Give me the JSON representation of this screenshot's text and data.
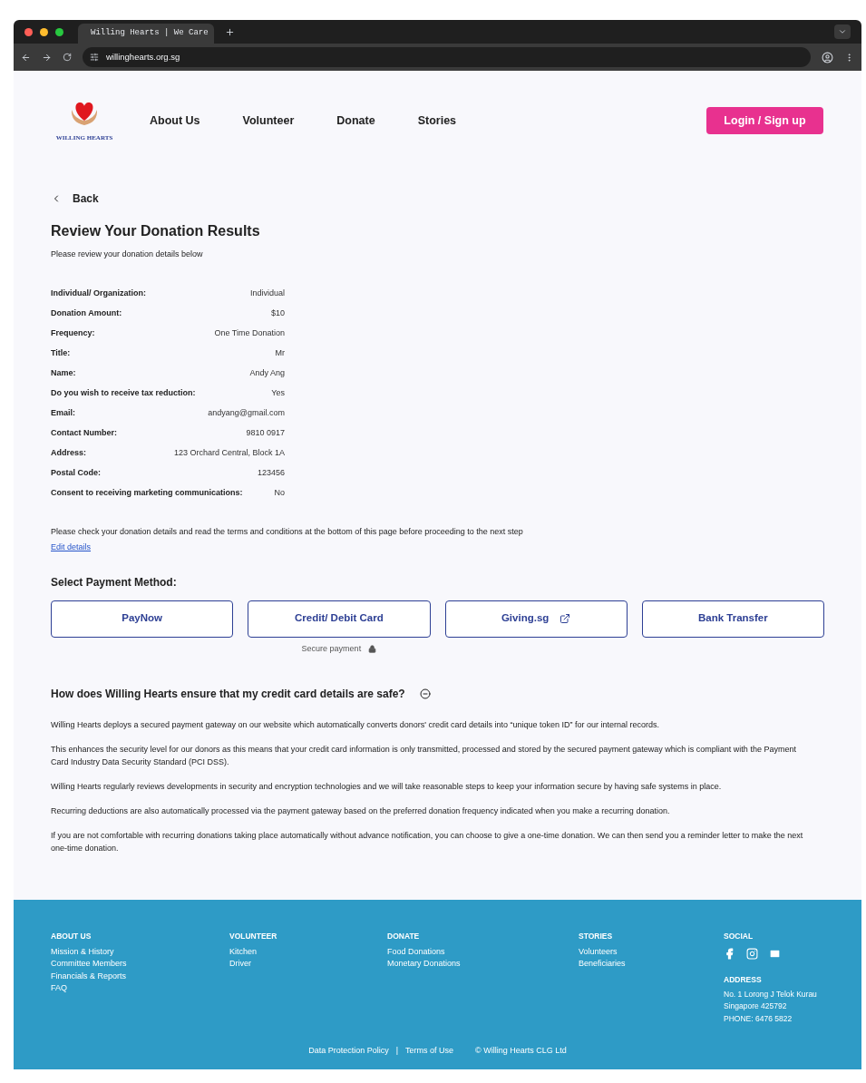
{
  "browser": {
    "tab_title": "Willing Hearts | We Care",
    "url": "willinghearts.org.sg"
  },
  "logo": {
    "text": "WILLING HEARTS"
  },
  "nav": [
    "About Us",
    "Volunteer",
    "Donate",
    "Stories"
  ],
  "login_button": "Login / Sign up",
  "back": "Back",
  "title": "Review Your Donation Results",
  "subtitle": "Please review your donation details below",
  "details": [
    {
      "label": "Individual/ Organization:",
      "value": "Individual"
    },
    {
      "label": "Donation Amount:",
      "value": "$10"
    },
    {
      "label": "Frequency:",
      "value": "One Time Donation"
    },
    {
      "label": "Title:",
      "value": "Mr"
    },
    {
      "label": "Name:",
      "value": "Andy Ang"
    },
    {
      "label": "Do you wish to receive tax reduction:",
      "value": "Yes"
    },
    {
      "label": "Email:",
      "value": "andyang@gmail.com"
    },
    {
      "label": "Contact Number:",
      "value": "9810 0917"
    },
    {
      "label": "Address:",
      "value": "123 Orchard Central, Block 1A"
    },
    {
      "label": "Postal Code:",
      "value": "123456"
    },
    {
      "label": "Consent to receiving marketing communications:",
      "value": "No"
    }
  ],
  "check_note": "Please check your donation details and read the terms and conditions at the bottom of this page before proceeding to the next step",
  "edit_link": "Edit details",
  "payment_heading": "Select Payment Method:",
  "payment_methods": [
    {
      "label": "PayNow",
      "kind": "plain"
    },
    {
      "label": "Credit/ Debit Card",
      "kind": "secure",
      "note": "Secure payment"
    },
    {
      "label": "Giving.sg",
      "kind": "external"
    },
    {
      "label": "Bank Transfer",
      "kind": "plain"
    }
  ],
  "faq": {
    "question": "How does Willing Hearts ensure that my credit card details are safe?",
    "expanded": true,
    "paragraphs": [
      "Willing Hearts deploys a secured payment gateway on our website which automatically converts donors' credit card details into “unique token ID” for our internal records.",
      "This enhances the security level for our donors as this means that your credit card information is only transmitted, processed and stored by the secured payment gateway which is compliant with the Payment Card Industry Data Security Standard (PCI DSS).",
      "Willing Hearts regularly reviews developments in security and encryption technologies and we will take reasonable steps to keep your information secure by having safe systems in place.",
      "Recurring deductions are also automatically processed via the payment gateway based on the preferred donation frequency indicated when you make a recurring donation.",
      "If you are not comfortable with recurring donations taking place automatically without advance notification, you can choose to give a one-time donation. We can then send you a reminder letter to make the next one-time donation."
    ]
  },
  "footer": {
    "columns": [
      {
        "heading": "ABOUT US",
        "links": [
          "Mission & History",
          "Committee Members",
          "Financials & Reports",
          "FAQ"
        ]
      },
      {
        "heading": "VOLUNTEER",
        "links": [
          "Kitchen",
          "Driver"
        ]
      },
      {
        "heading": "DONATE",
        "links": [
          "Food Donations",
          "Monetary Donations"
        ]
      },
      {
        "heading": "STORIES",
        "links": [
          "Volunteers",
          "Beneficiaries"
        ]
      }
    ],
    "social_heading": "SOCIAL",
    "social": [
      {
        "kind": "facebook"
      },
      {
        "kind": "instagram"
      },
      {
        "kind": "email"
      }
    ],
    "address_heading": "ADDRESS",
    "address_lines": [
      "No. 1 Lorong J Telok Kurau",
      "Singapore 425792",
      "PHONE: 6476 5822"
    ],
    "bottom_links": [
      "Data Protection Policy",
      "Terms of Use"
    ],
    "separator": "|",
    "copyright": "© Willing Hearts CLG Ltd"
  }
}
